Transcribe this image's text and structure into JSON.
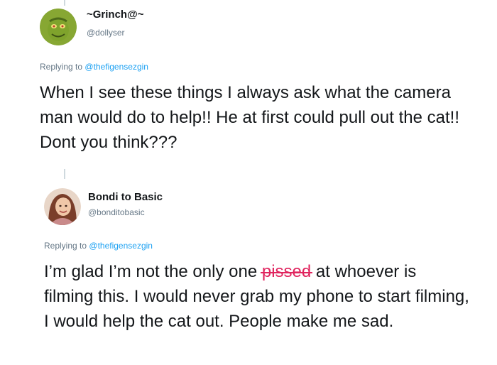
{
  "tweets": [
    {
      "display_name": "~Grinch@~",
      "handle": "@dollyser",
      "replying_prefix": "Replying to",
      "replying_handle": "@thefigensezgin",
      "text": "When I see these things I always ask what the camera man would do to help!! He at first could pull out the cat!! Dont you think???",
      "avatar_icon": "grinch-avatar"
    },
    {
      "display_name": "Bondi to Basic",
      "handle": "@bonditobasic",
      "replying_prefix": "Replying to",
      "replying_handle": "@thefigensezgin",
      "text_before": "I’m glad I’m not the only one ",
      "text_struck": "pissed",
      "text_after": " at whoever is filming this. I would never grab my phone to start filming, I would help the cat out. People make me sad.",
      "avatar_icon": "profile-photo-avatar"
    }
  ],
  "colors": {
    "link": "#1da1f2",
    "secondary_text": "#657786",
    "primary_text": "#14171a",
    "strikethrough": "#e0245e",
    "thread_line": "#cfd9de"
  }
}
